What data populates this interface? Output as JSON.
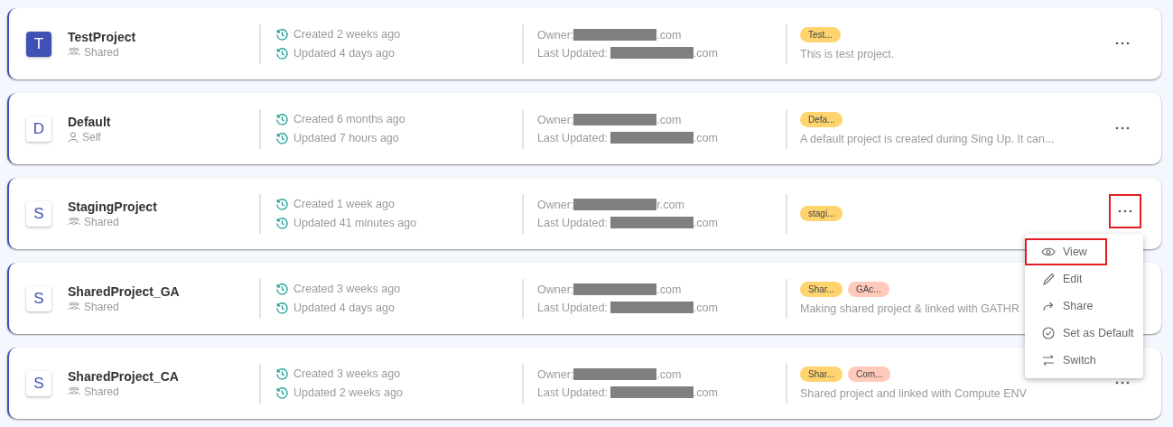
{
  "projects": [
    {
      "initial": "T",
      "active": true,
      "name": "TestProject",
      "access": {
        "kind": "shared",
        "label": "Shared"
      },
      "created": "Created 2 weeks ago",
      "updated": "Updated 4 days ago",
      "owner": {
        "label": "Owner:",
        "suffix": ".com"
      },
      "last_updated": {
        "label": "Last Updated:",
        "suffix": ".com"
      },
      "tags": [
        {
          "label": "Test...",
          "color": "#ffd36e"
        }
      ],
      "description": "This is test project.",
      "more_button": {
        "highlighted": false
      }
    },
    {
      "initial": "D",
      "active": false,
      "name": "Default",
      "access": {
        "kind": "self",
        "label": "Self"
      },
      "created": "Created 6 months ago",
      "updated": "Updated 7 hours ago",
      "owner": {
        "label": "Owner:",
        "suffix": ".com"
      },
      "last_updated": {
        "label": "Last Updated:",
        "suffix": ".com"
      },
      "tags": [
        {
          "label": "Defa...",
          "color": "#ffd36e"
        }
      ],
      "description": "A default project is created during Sing Up. It can...",
      "more_button": {
        "highlighted": false
      }
    },
    {
      "initial": "S",
      "active": false,
      "name": "StagingProject",
      "access": {
        "kind": "shared",
        "label": "Shared"
      },
      "created": "Created 1 week ago",
      "updated": "Updated 41 minutes ago",
      "owner": {
        "label": "Owner:",
        "suffix": "r.com"
      },
      "last_updated": {
        "label": "Last Updated:",
        "suffix": ".com"
      },
      "tags": [
        {
          "label": "stagi...",
          "color": "#ffd36e"
        }
      ],
      "more_button": {
        "highlighted": true
      }
    },
    {
      "initial": "S",
      "active": false,
      "name": "SharedProject_GA",
      "access": {
        "kind": "shared",
        "label": "Shared"
      },
      "created": "Created 3 weeks ago",
      "updated": "Updated 4 days ago",
      "owner": {
        "label": "Owner:",
        "suffix": ".com"
      },
      "last_updated": {
        "label": "Last Updated:",
        "suffix": ".com"
      },
      "tags": [
        {
          "label": "Shar...",
          "color": "#ffd36e"
        },
        {
          "label": "GAc...",
          "color": "#ffcabb"
        }
      ],
      "description": "Making shared project & linked with GATHR"
    },
    {
      "initial": "S",
      "active": false,
      "name": "SharedProject_CA",
      "access": {
        "kind": "shared",
        "label": "Shared"
      },
      "created": "Created 3 weeks ago",
      "updated": "Updated 2 weeks ago",
      "owner": {
        "label": "Owner:",
        "suffix": ".com"
      },
      "last_updated": {
        "label": "Last Updated:",
        "suffix": ".com"
      },
      "tags": [
        {
          "label": "Shar...",
          "color": "#ffd36e"
        },
        {
          "label": "Com...",
          "color": "#ffcabb"
        }
      ],
      "description": "Shared project and linked with Compute ENV",
      "more_button": {
        "highlighted": false
      }
    }
  ],
  "menu": {
    "items": [
      {
        "kind": "view",
        "label": "View",
        "highlighted": true
      },
      {
        "kind": "edit",
        "label": "Edit",
        "highlighted": false
      },
      {
        "kind": "share",
        "label": "Share",
        "highlighted": false
      },
      {
        "kind": "default",
        "label": "Set as Default",
        "highlighted": false
      },
      {
        "kind": "switch",
        "label": "Switch",
        "highlighted": false
      }
    ]
  }
}
